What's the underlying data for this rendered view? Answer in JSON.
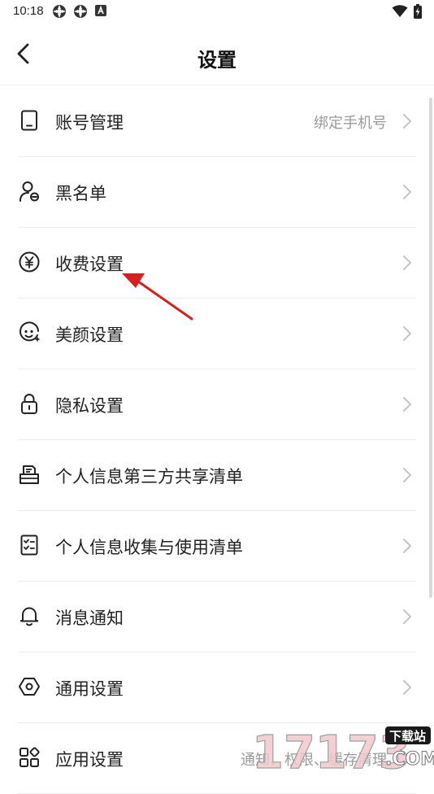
{
  "status_bar": {
    "time": "10:18"
  },
  "header": {
    "title": "设置"
  },
  "rows": [
    {
      "label": "账号管理",
      "value": "绑定手机号",
      "icon": "phone-icon"
    },
    {
      "label": "黑名单",
      "value": "",
      "icon": "user-block-icon"
    },
    {
      "label": "收费设置",
      "value": "",
      "icon": "yen-icon"
    },
    {
      "label": "美颜设置",
      "value": "",
      "icon": "face-icon"
    },
    {
      "label": "隐私设置",
      "value": "",
      "icon": "lock-icon"
    },
    {
      "label": "个人信息第三方共享清单",
      "value": "",
      "icon": "share-list-icon"
    },
    {
      "label": "个人信息收集与使用清单",
      "value": "",
      "icon": "checklist-icon"
    },
    {
      "label": "消息通知",
      "value": "",
      "icon": "bell-icon"
    },
    {
      "label": "通用设置",
      "value": "",
      "icon": "hexagon-icon"
    },
    {
      "label": "应用设置",
      "value": "通知、权限、缓存清理",
      "icon": "apps-icon"
    }
  ],
  "watermark": {
    "text": "17173",
    "sub": "下载站",
    "com": ".COM"
  },
  "colors": {
    "annotation_arrow": "#d62020",
    "divider": "#ededed"
  }
}
